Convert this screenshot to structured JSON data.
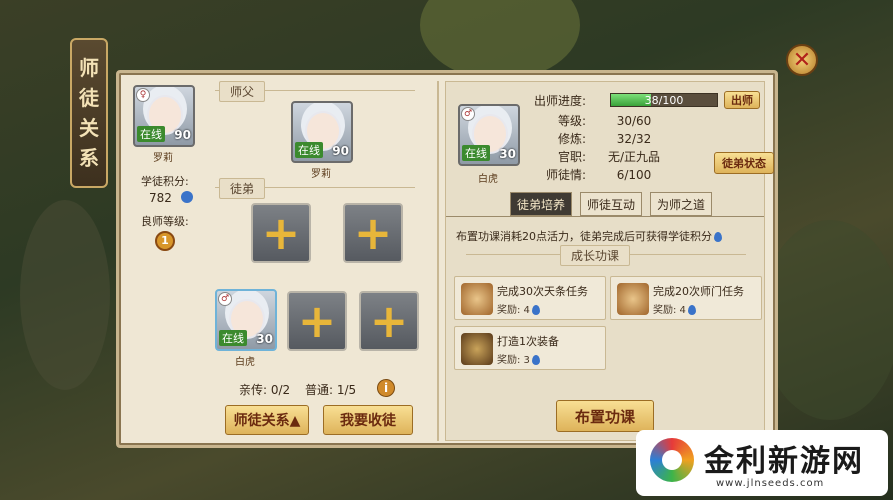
{
  "title_vertical": [
    "师",
    "徒",
    "关",
    "系"
  ],
  "close_symbol": "✕",
  "left": {
    "self": {
      "online": "在线",
      "level": "90",
      "name": "罗莉"
    },
    "points_label": "学徒积分:",
    "points_value": "782",
    "mentor_rank_label": "良师等级:",
    "mentor_rank_value": "1",
    "master_section": "师父",
    "master": {
      "online": "在线",
      "level": "90",
      "name": "罗莉"
    },
    "apprentice_section": "徒弟",
    "apprentice": {
      "online": "在线",
      "level": "30",
      "name": "白虎"
    },
    "add_symbol": "+",
    "direct_count": "亲传: 0/2",
    "normal_count": "普通: 1/5",
    "info_symbol": "i",
    "relation_button": "师徒关系▲",
    "recruit_button": "我要收徒"
  },
  "right": {
    "apprentice": {
      "online": "在线",
      "level": "30",
      "name": "白虎"
    },
    "stats": [
      {
        "label": "出师进度:",
        "value": "38/100"
      },
      {
        "label": "等级:",
        "value": "30/60"
      },
      {
        "label": "修炼:",
        "value": "32/32"
      },
      {
        "label": "官职:",
        "value": "无/正九品"
      },
      {
        "label": "师徒情:",
        "value": "6/100"
      }
    ],
    "progress_fraction": 0.38,
    "graduate_button": "出师",
    "status_button": "徒弟状态",
    "tabs": [
      "徒弟培养",
      "师徒互动",
      "为师之道"
    ],
    "description": "布置功课消耗20点活力，徒弟完成后可获得学徒积分",
    "growth_header": "成长功课",
    "tasks": [
      {
        "title": "完成30次天条任务",
        "reward": "奖励: 4"
      },
      {
        "title": "完成20次师门任务",
        "reward": "奖励: 4"
      },
      {
        "title": "打造1次装备",
        "reward": "奖励: 3"
      }
    ],
    "assign_button": "布置功课"
  },
  "watermark": {
    "text": "金利新游网",
    "url": "www.jlnseeds.com"
  }
}
